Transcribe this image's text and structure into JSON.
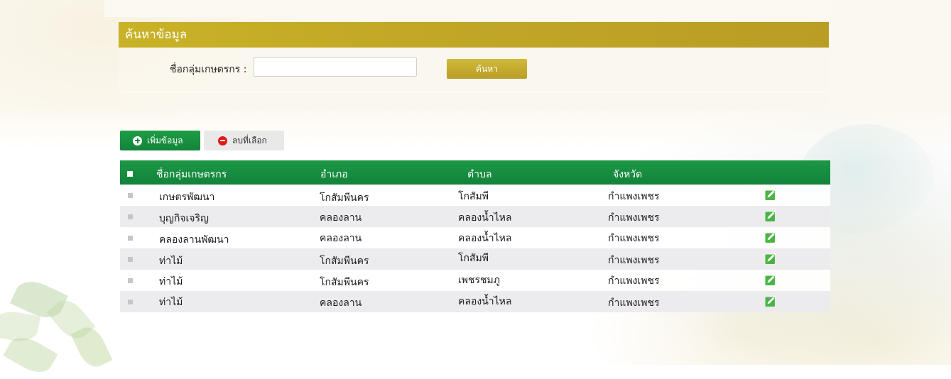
{
  "search": {
    "title": "ค้นหาข้อมูล",
    "label": "ชื่อกลุ่มเกษตรกร :",
    "input_value": "",
    "button_label": "ค้นหา"
  },
  "actions": {
    "add_label": "เพิ่มข้อมูล",
    "delete_label": "ลบที่เลือก"
  },
  "table": {
    "headers": [
      "ชื่อกลุ่มเกษตรกร",
      "อำเภอ",
      "ตำบล",
      "จังหวัด"
    ],
    "rows": [
      [
        "เกษตรพัฒนา",
        "โกสัมพีนคร",
        "โกสัมพี",
        "กำแพงเพชร"
      ],
      [
        "บุญกิจเจริญ",
        "คลองลาน",
        "คลองน้ำไหล",
        "กำแพงเพชร"
      ],
      [
        "คลองลานพัฒนา",
        "คลองลาน",
        "คลองน้ำไหล",
        "กำแพงเพชร"
      ],
      [
        "ท่าไม้",
        "โกสัมพีนคร",
        "โกสัมพี",
        "กำแพงเพชร"
      ],
      [
        "ท่าไม้",
        "โกสัมพีนคร",
        "เพชรชมภู",
        "กำแพงเพชร"
      ],
      [
        "ท่าไม้",
        "คลองลาน",
        "คลองน้ำไหล",
        "กำแพงเพชร"
      ]
    ]
  },
  "colors": {
    "search_header": "#c2a826",
    "table_header": "#17903f",
    "add_button": "#1a9440",
    "delete_icon": "#e01818",
    "edit_icon": "#4bb543"
  },
  "icons": {
    "add": "plus-circle-icon",
    "delete": "minus-circle-icon",
    "edit": "edit-icon"
  }
}
